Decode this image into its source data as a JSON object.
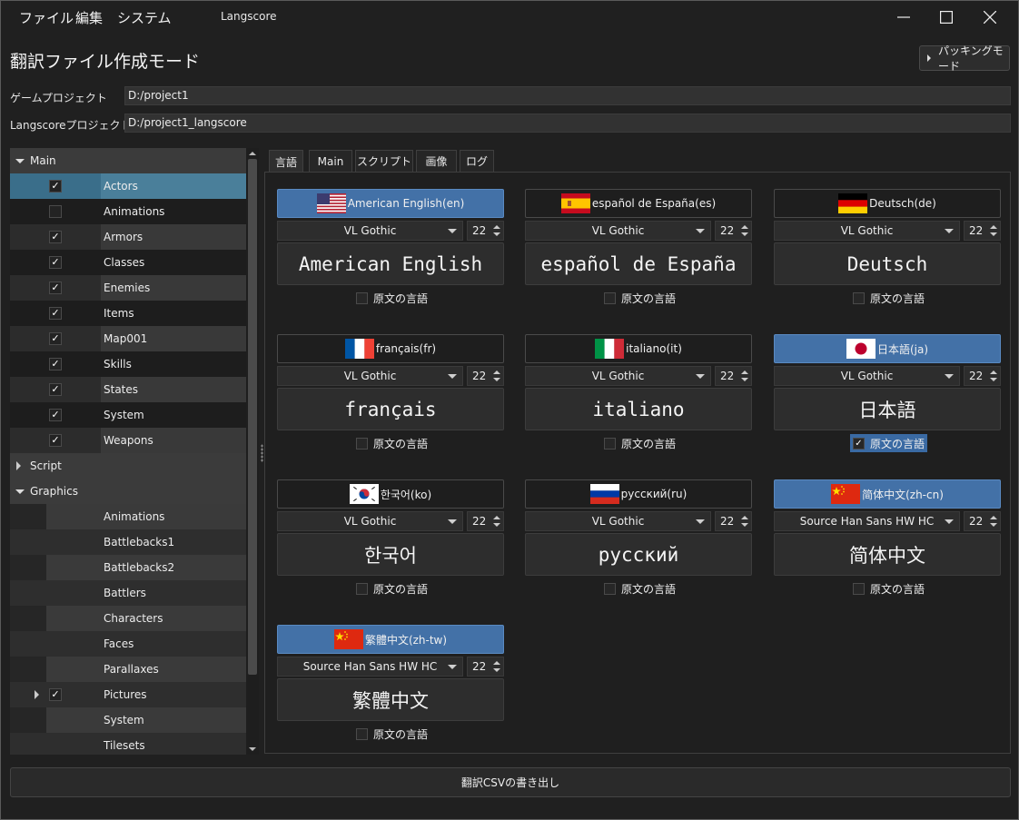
{
  "menu": {
    "file": "ファイル",
    "edit": "編集",
    "system": "システム"
  },
  "window": {
    "title": "Langscore"
  },
  "page": {
    "title": "翻訳ファイル作成モード",
    "pack_button": "パッキングモード"
  },
  "paths": {
    "game_label": "ゲームプロジェクト",
    "game_value": "D:/project1",
    "langscore_label": "Langscoreプロジェクト",
    "langscore_value": "D:/project1_langscore"
  },
  "tree": {
    "main": "Main",
    "main_items": [
      {
        "label": "Actors",
        "checked": true
      },
      {
        "label": "Animations",
        "checked": false
      },
      {
        "label": "Armors",
        "checked": true
      },
      {
        "label": "Classes",
        "checked": true
      },
      {
        "label": "Enemies",
        "checked": true
      },
      {
        "label": "Items",
        "checked": true
      },
      {
        "label": "Map001",
        "checked": true
      },
      {
        "label": "Skills",
        "checked": true
      },
      {
        "label": "States",
        "checked": true
      },
      {
        "label": "System",
        "checked": true
      },
      {
        "label": "Weapons",
        "checked": true
      }
    ],
    "script": "Script",
    "graphics": "Graphics",
    "graphics_items": [
      "Animations",
      "Battlebacks1",
      "Battlebacks2",
      "Battlers",
      "Characters",
      "Faces",
      "Parallaxes",
      "Pictures",
      "System",
      "Tilesets"
    ]
  },
  "tabs": [
    "言語",
    "Main",
    "スクリプト",
    "画像",
    "ログ"
  ],
  "langs": [
    {
      "header": "American English(en)",
      "font": "VL Gothic",
      "size": "22",
      "sample": "American English",
      "selected": true,
      "orig_checked": false,
      "flag": "us"
    },
    {
      "header": "español de España(es)",
      "font": "VL Gothic",
      "size": "22",
      "sample": "español de España",
      "selected": false,
      "orig_checked": false,
      "flag": "es"
    },
    {
      "header": "Deutsch(de)",
      "font": "VL Gothic",
      "size": "22",
      "sample": "Deutsch",
      "selected": false,
      "orig_checked": false,
      "flag": "de"
    },
    {
      "header": "français(fr)",
      "font": "VL Gothic",
      "size": "22",
      "sample": "français",
      "selected": false,
      "orig_checked": false,
      "flag": "fr"
    },
    {
      "header": "italiano(it)",
      "font": "VL Gothic",
      "size": "22",
      "sample": "italiano",
      "selected": false,
      "orig_checked": false,
      "flag": "it"
    },
    {
      "header": "日本語(ja)",
      "font": "VL Gothic",
      "size": "22",
      "sample": "日本語",
      "selected": true,
      "orig_checked": true,
      "flag": "jp"
    },
    {
      "header": "한국어(ko)",
      "font": "VL Gothic",
      "size": "22",
      "sample": "한국어",
      "selected": false,
      "orig_checked": false,
      "flag": "kr"
    },
    {
      "header": "русский(ru)",
      "font": "VL Gothic",
      "size": "22",
      "sample": "русский",
      "selected": false,
      "orig_checked": false,
      "flag": "ru"
    },
    {
      "header": "简体中文(zh-cn)",
      "font": "Source Han Sans HW HC",
      "size": "22",
      "sample": "简体中文",
      "selected": true,
      "orig_checked": false,
      "flag": "cn"
    },
    {
      "header": "繁體中文(zh-tw)",
      "font": "Source Han Sans HW HC",
      "size": "22",
      "sample": "繁體中文",
      "selected": true,
      "orig_checked": false,
      "flag": "cn"
    }
  ],
  "orig_label": "原文の言語",
  "export_button": "翻訳CSVの書き出し",
  "colors": {
    "accent": "#4371a7",
    "bg": "#202020"
  }
}
